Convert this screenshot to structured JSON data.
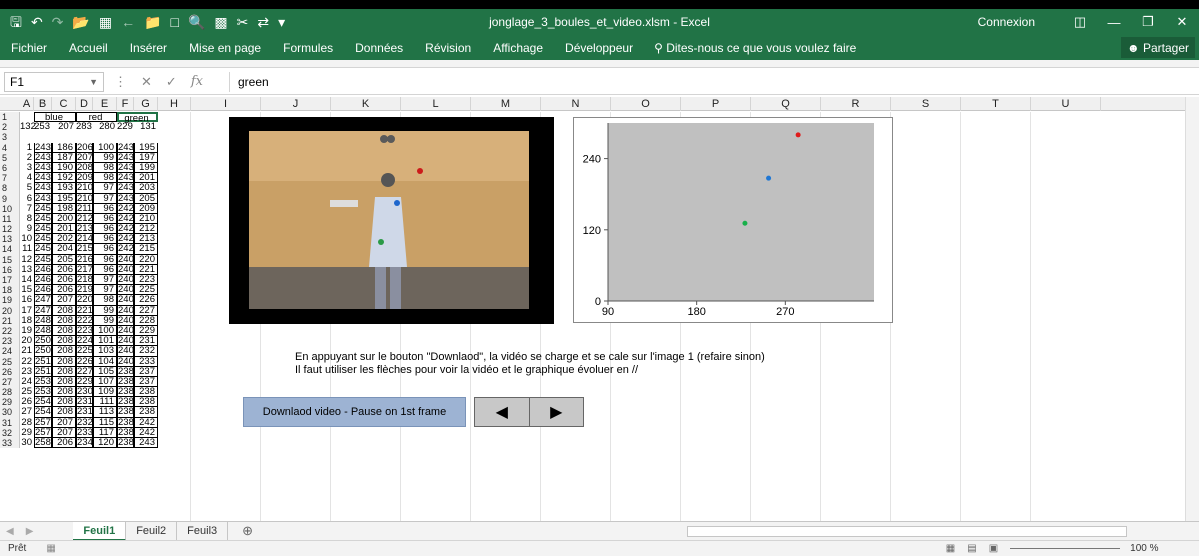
{
  "titlebar": {
    "filename": "jonglage_3_boules_et_video.xlsm - Excel",
    "connexion": "Connexion",
    "qat_icons": [
      "save-icon",
      "undo-icon",
      "redo-icon",
      "open-icon",
      "form-icon",
      "back-icon",
      "folder-icon",
      "new-icon",
      "print-preview-icon",
      "table-icon",
      "paste-icon",
      "sync-icon",
      "customize-icon"
    ]
  },
  "ribbon": {
    "tabs": [
      "Fichier",
      "Accueil",
      "Insérer",
      "Mise en page",
      "Formules",
      "Données",
      "Révision",
      "Affichage",
      "Développeur"
    ],
    "tell_me": "Dites-nous ce que vous voulez faire",
    "share": "Partager"
  },
  "formula": {
    "namebox": "F1",
    "content": "green",
    "fx": "fx"
  },
  "columns": [
    "A",
    "B",
    "C",
    "D",
    "E",
    "F",
    "G",
    "H",
    "I",
    "J",
    "K",
    "L",
    "M",
    "N",
    "O",
    "P",
    "Q",
    "R",
    "S",
    "T",
    "U"
  ],
  "headers_row1": {
    "blue": "blue",
    "red": "red",
    "green": "green"
  },
  "row2": [
    "132",
    "253",
    "207",
    "283",
    "280",
    "229",
    "131"
  ],
  "data_rows": [
    [
      "1",
      "243",
      "186",
      "206",
      "100",
      "243",
      "195"
    ],
    [
      "2",
      "243",
      "187",
      "207",
      "99",
      "243",
      "197"
    ],
    [
      "3",
      "243",
      "190",
      "208",
      "98",
      "243",
      "199"
    ],
    [
      "4",
      "243",
      "192",
      "209",
      "98",
      "243",
      "201"
    ],
    [
      "5",
      "243",
      "193",
      "210",
      "97",
      "243",
      "203"
    ],
    [
      "6",
      "243",
      "195",
      "210",
      "97",
      "243",
      "205"
    ],
    [
      "7",
      "245",
      "198",
      "211",
      "96",
      "242",
      "209"
    ],
    [
      "8",
      "245",
      "200",
      "212",
      "96",
      "242",
      "210"
    ],
    [
      "9",
      "245",
      "201",
      "213",
      "96",
      "242",
      "212"
    ],
    [
      "10",
      "245",
      "202",
      "214",
      "96",
      "242",
      "213"
    ],
    [
      "11",
      "245",
      "204",
      "215",
      "96",
      "242",
      "215"
    ],
    [
      "12",
      "245",
      "205",
      "216",
      "96",
      "240",
      "220"
    ],
    [
      "13",
      "246",
      "206",
      "217",
      "96",
      "240",
      "221"
    ],
    [
      "14",
      "246",
      "206",
      "218",
      "97",
      "240",
      "223"
    ],
    [
      "15",
      "246",
      "206",
      "219",
      "97",
      "240",
      "225"
    ],
    [
      "16",
      "247",
      "207",
      "220",
      "98",
      "240",
      "226"
    ],
    [
      "17",
      "247",
      "208",
      "221",
      "99",
      "240",
      "227"
    ],
    [
      "18",
      "248",
      "208",
      "222",
      "99",
      "240",
      "228"
    ],
    [
      "19",
      "248",
      "208",
      "223",
      "100",
      "240",
      "229"
    ],
    [
      "20",
      "250",
      "208",
      "224",
      "101",
      "240",
      "231"
    ],
    [
      "21",
      "250",
      "208",
      "225",
      "103",
      "240",
      "232"
    ],
    [
      "22",
      "251",
      "208",
      "226",
      "104",
      "240",
      "233"
    ],
    [
      "23",
      "251",
      "208",
      "227",
      "105",
      "238",
      "237"
    ],
    [
      "24",
      "253",
      "208",
      "229",
      "107",
      "238",
      "237"
    ],
    [
      "25",
      "253",
      "208",
      "230",
      "109",
      "238",
      "238"
    ],
    [
      "26",
      "254",
      "208",
      "231",
      "111",
      "238",
      "238"
    ],
    [
      "27",
      "254",
      "208",
      "231",
      "113",
      "238",
      "238"
    ],
    [
      "28",
      "257",
      "207",
      "232",
      "115",
      "238",
      "242"
    ],
    [
      "29",
      "257",
      "207",
      "233",
      "117",
      "238",
      "242"
    ],
    [
      "30",
      "258",
      "206",
      "234",
      "120",
      "238",
      "243"
    ]
  ],
  "notes": {
    "line1": "En appuyant sur le bouton \"Downlaod\", la vidéo se charge et se cale sur l'image 1 (refaire sinon)",
    "line2": "Il faut utiliser les flèches pour voir la vidéo et le graphique évoluer en //"
  },
  "buttons": {
    "download": "Downlaod video - Pause on 1st frame",
    "prev": "◀",
    "next": "▶"
  },
  "chart_data": {
    "type": "scatter",
    "xlim": [
      90,
      360
    ],
    "ylim": [
      0,
      300
    ],
    "xticks": [
      "90",
      "180",
      "270"
    ],
    "yticks": [
      "0",
      "120",
      "240"
    ],
    "series": [
      {
        "values": [
          [
            253,
            207
          ]
        ],
        "color": "#1f77d4"
      },
      {
        "values": [
          [
            283,
            280
          ]
        ],
        "color": "#e01b1b"
      },
      {
        "values": [
          [
            229,
            131
          ]
        ],
        "color": "#18b04a"
      }
    ],
    "background": "#c0c0c0"
  },
  "sheets": [
    "Feuil1",
    "Feuil2",
    "Feuil3"
  ],
  "status": {
    "ready": "Prêt",
    "zoom": "100 %"
  }
}
